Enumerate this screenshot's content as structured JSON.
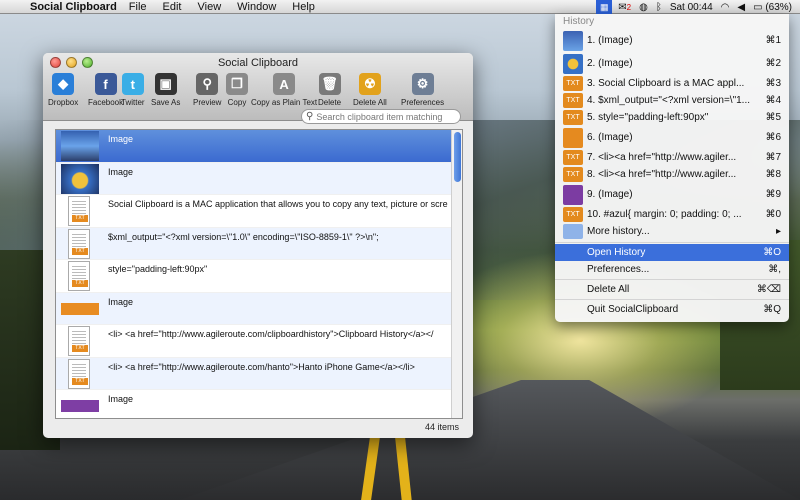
{
  "menubar": {
    "apple": "",
    "app_name": "Social Clipboard",
    "menus": [
      "File",
      "Edit",
      "View",
      "Window",
      "Help"
    ],
    "clock": "Sat 00:44",
    "battery": "(63%)",
    "mail_badge": "2"
  },
  "window": {
    "title": "Social Clipboard",
    "toolbar": [
      {
        "label": "Dropbox",
        "icon": "dropbox-icon",
        "glyph": "◆",
        "color": "#2a7fd8"
      },
      {
        "label": "Facebook",
        "icon": "facebook-icon",
        "glyph": "f",
        "color": "#3b5998"
      },
      {
        "label": "Twitter",
        "icon": "twitter-icon",
        "glyph": "t",
        "color": "#3aaee6"
      },
      {
        "label": "Save As",
        "icon": "save-icon",
        "glyph": "▣",
        "color": "#333333"
      },
      {
        "label": "Preview",
        "icon": "preview-icon",
        "glyph": "⚲",
        "color": "#666666"
      },
      {
        "label": "Copy",
        "icon": "copy-icon",
        "glyph": "❐",
        "color": "#8a8a8a"
      },
      {
        "label": "Copy as Plain Text",
        "icon": "copy-plain-text-icon",
        "glyph": "A",
        "color": "#8a8a8a"
      },
      {
        "label": "Delete",
        "icon": "trash-icon",
        "glyph": "🗑",
        "color": "#7a7a7a"
      },
      {
        "label": "Delete All",
        "icon": "radiation-icon",
        "glyph": "☢",
        "color": "#e2a21c"
      },
      {
        "label": "Preferences",
        "icon": "gear-icon",
        "glyph": "⚙",
        "color": "#6e7e95"
      }
    ],
    "search_placeholder": "Search clipboard item matching",
    "items": [
      {
        "kind": "image",
        "thumb": "t1",
        "text": "Image"
      },
      {
        "kind": "image",
        "thumb": "t2",
        "text": "Image"
      },
      {
        "kind": "txt",
        "text": "Social Clipboard is a MAC application that allows you to copy any text, picture or scree"
      },
      {
        "kind": "txt",
        "text": "$xml_output=\"<?xml version=\\\"1.0\\\" encoding=\\\"ISO-8859-1\\\" ?>\\n\";"
      },
      {
        "kind": "txt",
        "text": "style=\"padding-left:90px\""
      },
      {
        "kind": "image",
        "thumb": "t3",
        "text": "Image"
      },
      {
        "kind": "txt",
        "text": "<li> <a href=\"http://www.agileroute.com/clipboardhistory\">Clipboard History</a></"
      },
      {
        "kind": "txt",
        "text": "<li> <a href=\"http://www.agileroute.com/hanto\">Hanto iPhone Game</a></li>"
      },
      {
        "kind": "image",
        "thumb": "t4",
        "text": "Image"
      }
    ],
    "badge_txt": "TXT",
    "count": "44 items"
  },
  "dropdown": {
    "header": "History",
    "items": [
      {
        "icon": "img1",
        "label": "1. (Image)",
        "shortcut": "⌘1"
      },
      {
        "icon": "img2",
        "label": "2. (Image)",
        "shortcut": "⌘2"
      },
      {
        "icon": "txt",
        "label": "3. Social Clipboard is a MAC appl...",
        "shortcut": "⌘3"
      },
      {
        "icon": "txt",
        "label": "4. $xml_output=\"<?xml version=\\\"1...",
        "shortcut": "⌘4"
      },
      {
        "icon": "txt",
        "label": "5. style=\"padding-left:90px\"",
        "shortcut": "⌘5"
      },
      {
        "icon": "img3",
        "label": "6. (Image)",
        "shortcut": "⌘6"
      },
      {
        "icon": "txt",
        "label": "7. <li><a href=\"http://www.agiler...",
        "shortcut": "⌘7"
      },
      {
        "icon": "txt",
        "label": "8. <li><a href=\"http://www.agiler...",
        "shortcut": "⌘8"
      },
      {
        "icon": "img4",
        "label": "9. (Image)",
        "shortcut": "⌘9"
      },
      {
        "icon": "txt",
        "label": "10. #azul{ margin: 0; padding: 0; ...",
        "shortcut": "⌘0"
      },
      {
        "icon": "folder",
        "label": "More history...",
        "shortcut": "▸"
      }
    ],
    "actions": [
      {
        "label": "Open History",
        "shortcut": "⌘O",
        "highlighted": true
      },
      {
        "label": "Preferences...",
        "shortcut": "⌘,"
      },
      {
        "label": "Delete All",
        "shortcut": "⌘⌫"
      },
      {
        "label": "Quit SocialClipboard",
        "shortcut": "⌘Q"
      }
    ],
    "accent": "#3b6fdb"
  }
}
